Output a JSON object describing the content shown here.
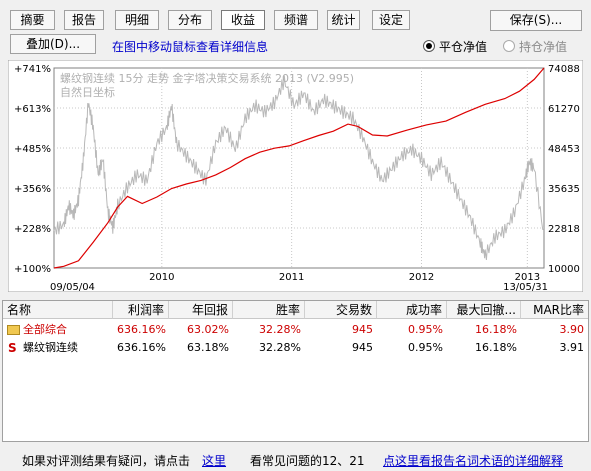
{
  "tabs": [
    "摘要",
    "报告",
    "明细",
    "分布",
    "收益",
    "频谱",
    "统计",
    "设定"
  ],
  "active_tab": "收益",
  "save_label": "保存(S)...",
  "overlay_label": "叠加(D)...",
  "hint_text": "在图中移动鼠标查看详细信息",
  "radio_flat": "平仓净值",
  "radio_hold": "持仓净值",
  "chart_data": {
    "type": "line",
    "title": "螺纹钢连续 15分 走势 金字塔决策交易系统 2013 (V2.995)",
    "subtitle": "自然日坐标",
    "y_left_ticks": [
      "+741%",
      "+613%",
      "+485%",
      "+356%",
      "+228%",
      "+100%"
    ],
    "y_right_ticks": [
      "74088",
      "61270",
      "48453",
      "35635",
      "22818",
      "10000"
    ],
    "x_start_label": "09/05/04",
    "x_end_label": "13/05/31",
    "x_year_labels": [
      "2010",
      "2011",
      "2012",
      "2013"
    ],
    "ylim_percent": [
      100,
      741
    ],
    "ylim_price": [
      10000,
      74088
    ],
    "equity_curve_color": "#dd0000",
    "price_curve_color": "#b8b8b8",
    "equity_percent": [
      [
        0,
        100
      ],
      [
        0.02,
        110
      ],
      [
        0.05,
        120
      ],
      [
        0.08,
        180
      ],
      [
        0.11,
        250
      ],
      [
        0.13,
        295
      ],
      [
        0.15,
        325
      ],
      [
        0.18,
        310
      ],
      [
        0.21,
        330
      ],
      [
        0.24,
        350
      ],
      [
        0.27,
        370
      ],
      [
        0.3,
        385
      ],
      [
        0.33,
        395
      ],
      [
        0.36,
        420
      ],
      [
        0.39,
        455
      ],
      [
        0.42,
        470
      ],
      [
        0.45,
        480
      ],
      [
        0.48,
        495
      ],
      [
        0.51,
        510
      ],
      [
        0.54,
        520
      ],
      [
        0.57,
        540
      ],
      [
        0.6,
        565
      ],
      [
        0.62,
        550
      ],
      [
        0.65,
        525
      ],
      [
        0.68,
        528
      ],
      [
        0.72,
        540
      ],
      [
        0.76,
        555
      ],
      [
        0.8,
        575
      ],
      [
        0.84,
        600
      ],
      [
        0.88,
        620
      ],
      [
        0.92,
        645
      ],
      [
        0.95,
        670
      ],
      [
        0.98,
        700
      ],
      [
        1.0,
        741
      ]
    ],
    "price": [
      [
        0,
        22000
      ],
      [
        0.02,
        24000
      ],
      [
        0.03,
        30000
      ],
      [
        0.04,
        27000
      ],
      [
        0.05,
        32000
      ],
      [
        0.06,
        45000
      ],
      [
        0.07,
        63000
      ],
      [
        0.08,
        55000
      ],
      [
        0.09,
        40000
      ],
      [
        0.1,
        45000
      ],
      [
        0.11,
        28000
      ],
      [
        0.12,
        23000
      ],
      [
        0.13,
        30000
      ],
      [
        0.15,
        36000
      ],
      [
        0.17,
        40000
      ],
      [
        0.19,
        38000
      ],
      [
        0.21,
        50000
      ],
      [
        0.23,
        55000
      ],
      [
        0.24,
        62000
      ],
      [
        0.25,
        50000
      ],
      [
        0.27,
        46000
      ],
      [
        0.29,
        42000
      ],
      [
        0.31,
        38000
      ],
      [
        0.33,
        50000
      ],
      [
        0.35,
        55000
      ],
      [
        0.37,
        48000
      ],
      [
        0.39,
        58000
      ],
      [
        0.41,
        62000
      ],
      [
        0.43,
        60000
      ],
      [
        0.45,
        63000
      ],
      [
        0.47,
        70000
      ],
      [
        0.49,
        62000
      ],
      [
        0.51,
        66000
      ],
      [
        0.53,
        60000
      ],
      [
        0.55,
        64000
      ],
      [
        0.57,
        62000
      ],
      [
        0.59,
        60000
      ],
      [
        0.61,
        58000
      ],
      [
        0.63,
        52000
      ],
      [
        0.65,
        44000
      ],
      [
        0.67,
        38000
      ],
      [
        0.69,
        42000
      ],
      [
        0.71,
        46000
      ],
      [
        0.73,
        48000
      ],
      [
        0.75,
        45000
      ],
      [
        0.77,
        40000
      ],
      [
        0.79,
        44000
      ],
      [
        0.81,
        38000
      ],
      [
        0.83,
        32000
      ],
      [
        0.85,
        26000
      ],
      [
        0.87,
        18000
      ],
      [
        0.88,
        14000
      ],
      [
        0.9,
        20000
      ],
      [
        0.92,
        22000
      ],
      [
        0.94,
        28000
      ],
      [
        0.96,
        38000
      ],
      [
        0.97,
        44000
      ],
      [
        0.98,
        42000
      ],
      [
        1.0,
        20000
      ]
    ]
  },
  "table": {
    "headers": [
      "名称",
      "利润率",
      "年回报",
      "胜率",
      "交易数",
      "成功率",
      "最大回撤...",
      "MAR比率"
    ],
    "rows": [
      {
        "name": "全部综合",
        "values": [
          "636.16%",
          "63.02%",
          "32.28%",
          "945",
          "0.95%",
          "16.18%",
          "3.90"
        ],
        "color": "#cc0000"
      },
      {
        "name": "螺纹钢连续",
        "values": [
          "636.16%",
          "63.18%",
          "32.28%",
          "945",
          "0.95%",
          "16.18%",
          "3.91"
        ],
        "color": "#000000"
      }
    ]
  },
  "footer": {
    "question": "如果对评测结果有疑问，请点击",
    "here_link": "这里",
    "faq": "看常见问题的12、21",
    "glossary_link": "点这里看报告名词术语的详细解释"
  }
}
